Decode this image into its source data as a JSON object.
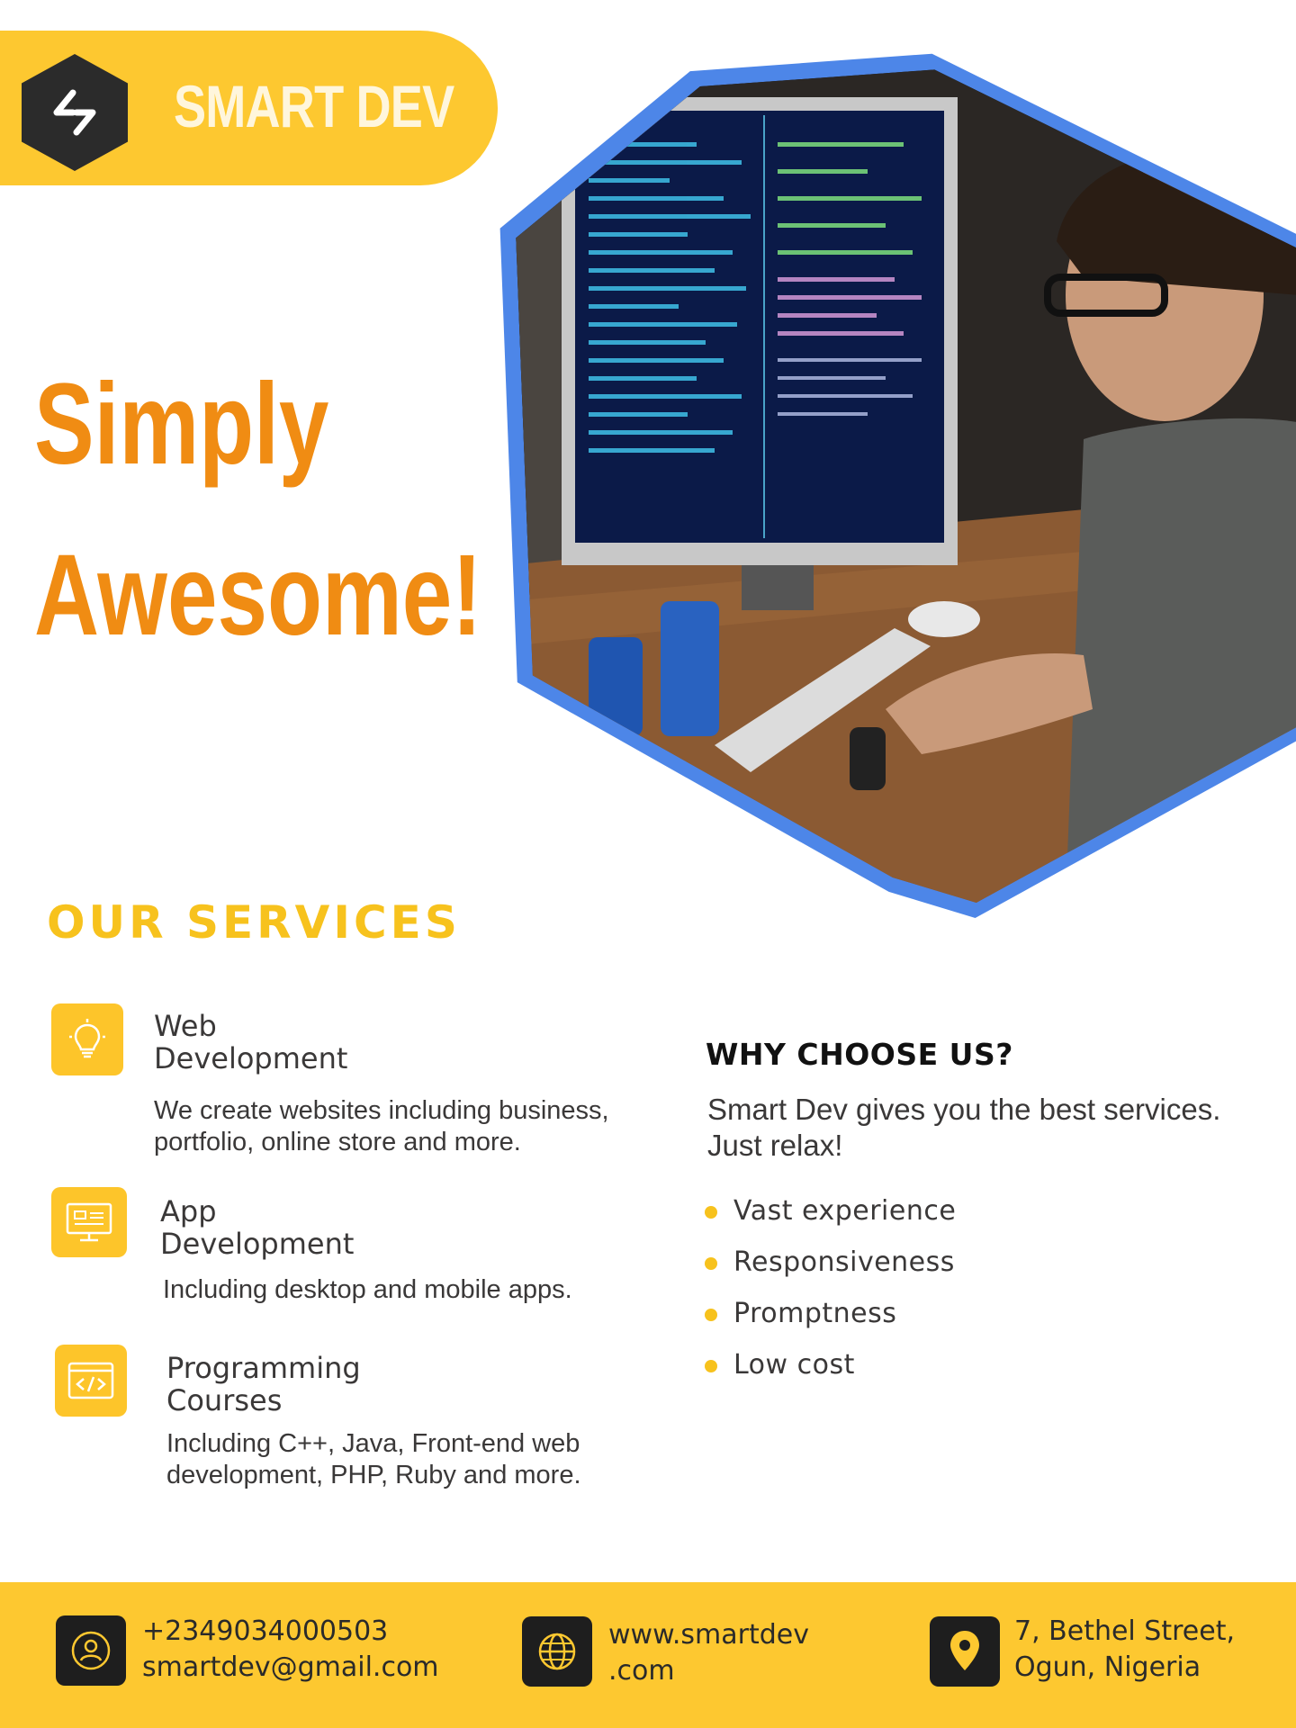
{
  "brand": {
    "name": "SMART DEV"
  },
  "hero": {
    "line1": "Simply",
    "line2": "Awesome!"
  },
  "services": {
    "title": "OUR SERVICES",
    "items": [
      {
        "title_line1": "Web",
        "title_line2": "Development",
        "desc_line1": "We create websites including business,",
        "desc_line2": "portfolio, online store and more.",
        "icon": "lightbulb-icon"
      },
      {
        "title_line1": "App",
        "title_line2": "Development",
        "desc_line1": "Including desktop and mobile apps.",
        "desc_line2": "",
        "icon": "monitor-icon"
      },
      {
        "title_line1": "Programming",
        "title_line2": "Courses",
        "desc_line1": "Including C++, Java, Front-end web",
        "desc_line2": "development, PHP, Ruby and more.",
        "icon": "code-window-icon"
      }
    ]
  },
  "why": {
    "title": "WHY CHOOSE US?",
    "text_line1": "Smart Dev gives you the best services.",
    "text_line2": "Just relax!",
    "items": [
      "Vast experience",
      "Responsiveness",
      "Promptness",
      "Low cost"
    ]
  },
  "footer": {
    "phone": "+2349034000503",
    "email": "smartdev@gmail.com",
    "web_line1": "www.smartdev",
    "web_line2": ".com",
    "address_line1": "7, Bethel Street,",
    "address_line2": "Ogun, Nigeria"
  },
  "colors": {
    "accent_yellow": "#fdc830",
    "headline_orange": "#f08c13",
    "frame_blue": "#4d86e8"
  }
}
